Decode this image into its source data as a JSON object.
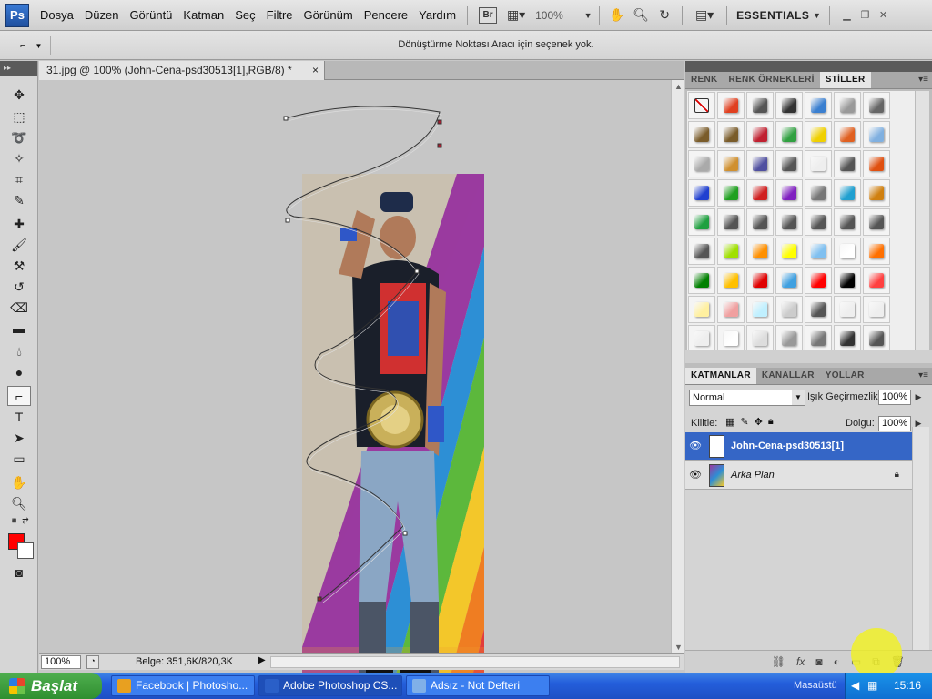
{
  "menubar": {
    "logo": "Ps",
    "items": [
      "Dosya",
      "Düzen",
      "Görüntü",
      "Katman",
      "Seç",
      "Filtre",
      "Görünüm",
      "Pencere",
      "Yardım"
    ],
    "bridge": "Br",
    "zoom": "100%",
    "workspace": "ESSENTIALS"
  },
  "options": {
    "message": "Dönüştürme Noktası Aracı için seçenek yok."
  },
  "document": {
    "tab_title": "31.jpg @ 100% (John-Cena-psd30513[1],RGB/8) *",
    "close": "×",
    "zoom_field": "100%",
    "info": "Belge: 351,6K/820,3K"
  },
  "styles_panel": {
    "tabs": [
      "RENK",
      "RENK ÖRNEKLERİ",
      "STİLLER"
    ],
    "active_tab": "STİLLER",
    "swatch_colors": [
      "none",
      "#e04020",
      "#555555",
      "#333333",
      "#3a7fd0",
      "#999999",
      "#666666",
      "#7a5c2a",
      "#7a5c2a",
      "#c02030",
      "#30a040",
      "#f0d000",
      "#e06020",
      "#80b0e0",
      "#aaaaaa",
      "#d09030",
      "#5050a0",
      "#555555",
      "#eeeeee",
      "#555555",
      "#e05010",
      "#2040d0",
      "#20a020",
      "#d02020",
      "#8020c0",
      "#777777",
      "#20a0d0",
      "#d08010",
      "#20a040",
      "#555555",
      "#555555",
      "#555555",
      "#555555",
      "#555555",
      "#555555",
      "#555555",
      "#a0e000",
      "#ff9000",
      "#ffff00",
      "#80c0f0",
      "#ffffff",
      "#ff7000",
      "#008000",
      "#ffc000",
      "#e00000",
      "#40a0e0",
      "#ff0000",
      "#000000",
      "#ff4040",
      "#fff0a0",
      "#f0a0a0",
      "#c0f0ff",
      "#cccccc",
      "#555555",
      "#eeeeee",
      "#eeeeee",
      "#eeeeee",
      "#ffffff",
      "#dddddd",
      "#999999",
      "#777777",
      "#333333",
      "#555555"
    ]
  },
  "layers_panel": {
    "tabs": [
      "KATMANLAR",
      "KANALLAR",
      "YOLLAR"
    ],
    "active_tab": "KATMANLAR",
    "blend_mode": "Normal",
    "opacity_label": "Işık Geçirmezlik:",
    "opacity": "100%",
    "lock_label": "Kilitle:",
    "fill_label": "Dolgu:",
    "fill": "100%",
    "layers": [
      {
        "name": "John-Cena-psd30513[1]",
        "selected": true
      },
      {
        "name": "Arka Plan",
        "selected": false
      }
    ]
  },
  "taskbar": {
    "start": "Başlat",
    "tasks": [
      {
        "label": "Facebook | Photosho...",
        "color": "#e8a020"
      },
      {
        "label": "Adobe Photoshop CS...",
        "color": "#2a5fc8"
      },
      {
        "label": "Adsız - Not Defteri",
        "color": "#80b0e8"
      }
    ],
    "desktop": "Masaüstü",
    "clock": "15:16"
  }
}
